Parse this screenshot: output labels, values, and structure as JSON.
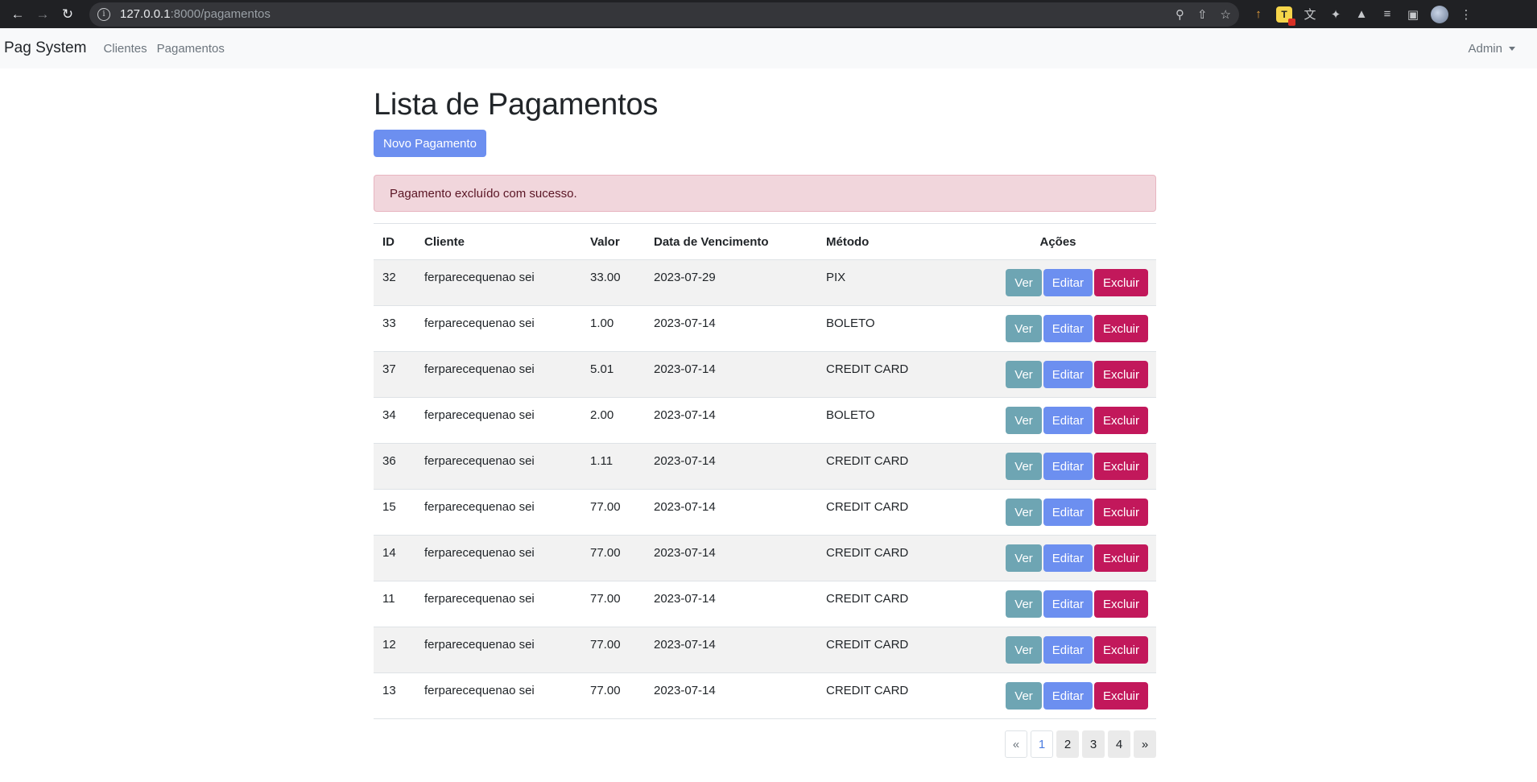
{
  "browser": {
    "url_host": "127.0.0.1",
    "url_rest": ":8000/pagamentos"
  },
  "navbar": {
    "brand": "Pag System",
    "links": [
      "Clientes",
      "Pagamentos"
    ],
    "user": "Admin"
  },
  "page": {
    "title": "Lista de Pagamentos",
    "new_button": "Novo Pagamento",
    "alert": "Pagamento excluído com sucesso."
  },
  "table": {
    "headers": [
      "ID",
      "Cliente",
      "Valor",
      "Data de Vencimento",
      "Método",
      "Ações"
    ],
    "action_labels": [
      "Ver",
      "Editar",
      "Excluir"
    ],
    "rows": [
      [
        "32",
        "ferparecequenao sei",
        "33.00",
        "2023-07-29",
        "PIX"
      ],
      [
        "33",
        "ferparecequenao sei",
        "1.00",
        "2023-07-14",
        "BOLETO"
      ],
      [
        "37",
        "ferparecequenao sei",
        "5.01",
        "2023-07-14",
        "CREDIT CARD"
      ],
      [
        "34",
        "ferparecequenao sei",
        "2.00",
        "2023-07-14",
        "BOLETO"
      ],
      [
        "36",
        "ferparecequenao sei",
        "1.11",
        "2023-07-14",
        "CREDIT CARD"
      ],
      [
        "15",
        "ferparecequenao sei",
        "77.00",
        "2023-07-14",
        "CREDIT CARD"
      ],
      [
        "14",
        "ferparecequenao sei",
        "77.00",
        "2023-07-14",
        "CREDIT CARD"
      ],
      [
        "11",
        "ferparecequenao sei",
        "77.00",
        "2023-07-14",
        "CREDIT CARD"
      ],
      [
        "12",
        "ferparecequenao sei",
        "77.00",
        "2023-07-14",
        "CREDIT CARD"
      ],
      [
        "13",
        "ferparecequenao sei",
        "77.00",
        "2023-07-14",
        "CREDIT CARD"
      ]
    ]
  },
  "pagination": {
    "prev": "«",
    "pages": [
      "1",
      "2",
      "3",
      "4"
    ],
    "current": "1",
    "next": "»"
  },
  "colors": {
    "primary": "#6c8ff0",
    "info": "#6ea5b3",
    "danger": "#c2185b",
    "alert_bg": "#f1d6dc"
  }
}
